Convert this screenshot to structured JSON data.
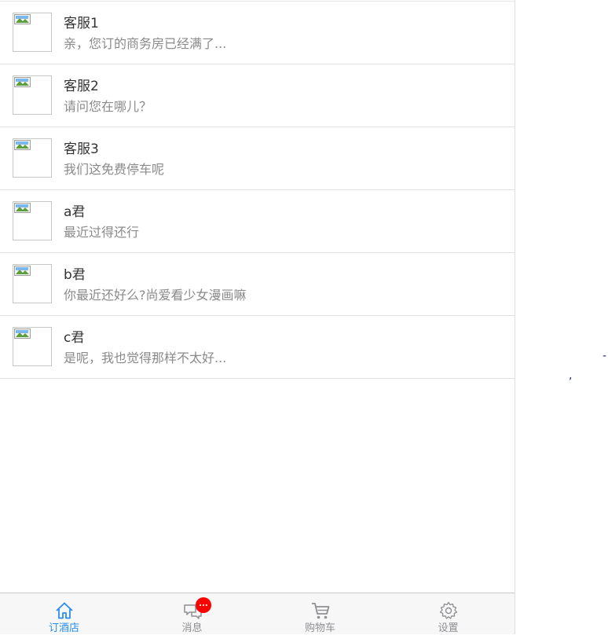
{
  "chats": [
    {
      "name": "客服1",
      "message": "亲，您订的商务房已经满了..."
    },
    {
      "name": "客服2",
      "message": "请问您在哪儿？"
    },
    {
      "name": "客服3",
      "message": "我们这免费停车呢"
    },
    {
      "name": "a君",
      "message": "最近过得还行"
    },
    {
      "name": "b君",
      "message": "你最近还好么?尚爱看少女漫画嘛"
    },
    {
      "name": "c君",
      "message": "是呢，我也觉得那样不太好..."
    }
  ],
  "tabbar": {
    "tabs": [
      {
        "label": "订酒店",
        "icon": "home-icon",
        "active": true
      },
      {
        "label": "消息",
        "icon": "chat-icon",
        "active": false
      },
      {
        "label": "购物车",
        "icon": "cart-icon",
        "active": false
      },
      {
        "label": "设置",
        "icon": "gear-icon",
        "active": false
      }
    ],
    "message_badge": "..."
  },
  "colors": {
    "active_tab": "#2a8cf0",
    "inactive_tab": "#8f8f94",
    "badge": "#ff0000"
  },
  "stray_marks": [
    ",",
    "-"
  ]
}
